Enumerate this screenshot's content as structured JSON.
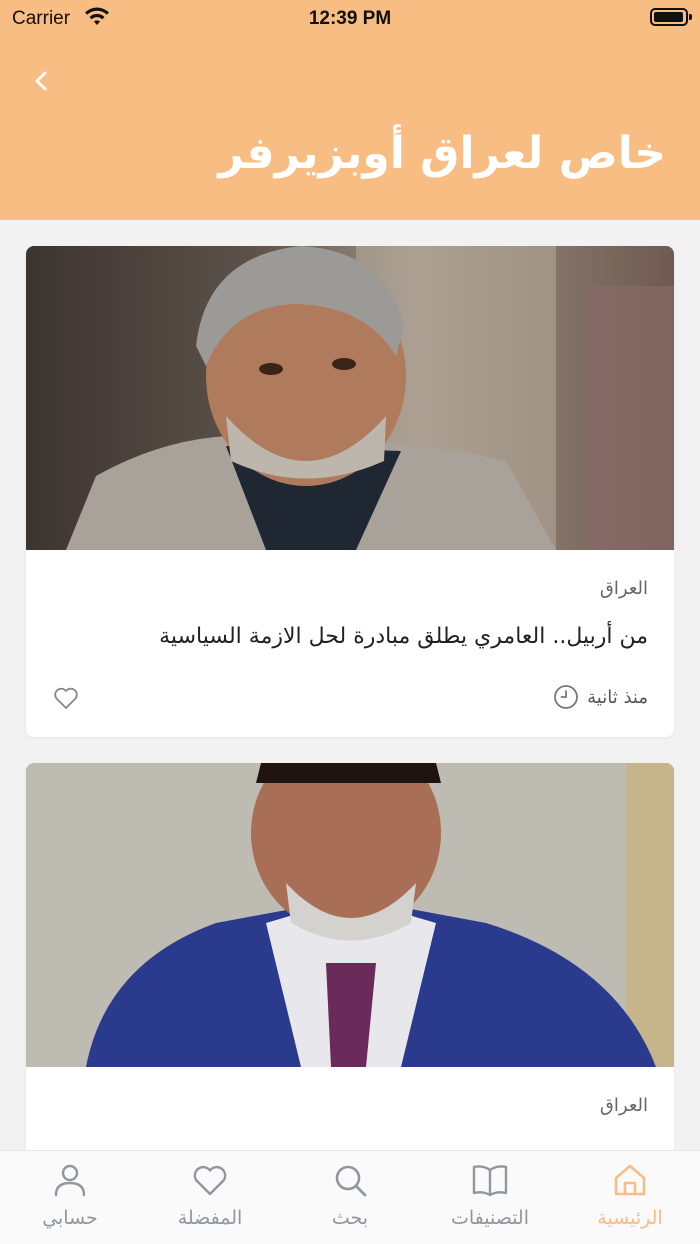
{
  "status_bar": {
    "carrier": "Carrier",
    "time": "12:39 PM"
  },
  "header": {
    "title": "خاص لعراق أوبزيرفر",
    "back_icon": "chevron-left-icon",
    "background": "#f8bd82"
  },
  "articles": [
    {
      "category": "العراق",
      "headline": "من أربيل.. العامري يطلق مبادرة لحل الازمة السياسية",
      "time_ago": "منذ ثانية",
      "image": "portrait of man with gray hair in gray suit"
    },
    {
      "category": "العراق",
      "headline": "",
      "image": "portrait of man with gray beard in blue suit"
    }
  ],
  "tab_bar": {
    "active_color": "#f8bd82",
    "inactive_color": "#8f97a0",
    "tabs": [
      {
        "label": "حسابي",
        "icon": "person-icon"
      },
      {
        "label": "المفضلة",
        "icon": "heart-icon"
      },
      {
        "label": "بحث",
        "icon": "search-icon"
      },
      {
        "label": "التصنيفات",
        "icon": "book-icon"
      },
      {
        "label": "الرئيسية",
        "icon": "home-icon",
        "active": true
      }
    ]
  }
}
